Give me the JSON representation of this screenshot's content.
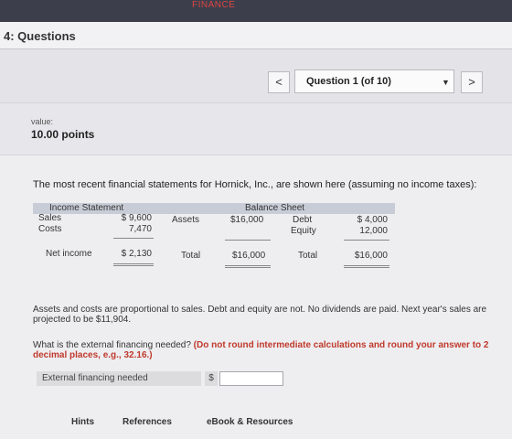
{
  "app": {
    "banner": "FINANCE",
    "section_title": "4: Questions"
  },
  "navigation": {
    "prev_label": "<",
    "question_select": "Question 1 (of 10)",
    "dropdown_caret": "▼",
    "next_label": ">"
  },
  "value": {
    "label": "value:",
    "points": "10.00 points"
  },
  "question": {
    "intro": "The most recent financial statements for Hornick, Inc., are shown here (assuming no income taxes):",
    "income_statement": {
      "title": "Income Statement",
      "sales_label": "Sales",
      "sales_value": "$ 9,600",
      "costs_label": "Costs",
      "costs_value": "7,470",
      "net_income_label": "Net income",
      "net_income_value": "$ 2,130"
    },
    "balance_sheet": {
      "title": "Balance Sheet",
      "assets_label": "Assets",
      "assets_value": "$16,000",
      "total_left_label": "Total",
      "total_left_value": "$16,000",
      "debt_label": "Debt",
      "debt_value": "$ 4,000",
      "equity_label": "Equity",
      "equity_value": "12,000",
      "total_right_label": "Total",
      "total_right_value": "$16,000"
    },
    "paragraph1": "Assets and costs are proportional to sales. Debt and equity are not. No dividends are paid. Next year's sales are projected to be $11,904.",
    "paragraph2_normal": "What is the external financing needed? ",
    "paragraph2_red": "(Do not round intermediate calculations and round your answer to 2 decimal places, e.g., 32.16.)",
    "answer_label": "External financing needed",
    "answer_currency": "$",
    "answer_value": ""
  },
  "footer_tabs": {
    "hints": "Hints",
    "references": "References",
    "ebook": "eBook & Resources"
  }
}
